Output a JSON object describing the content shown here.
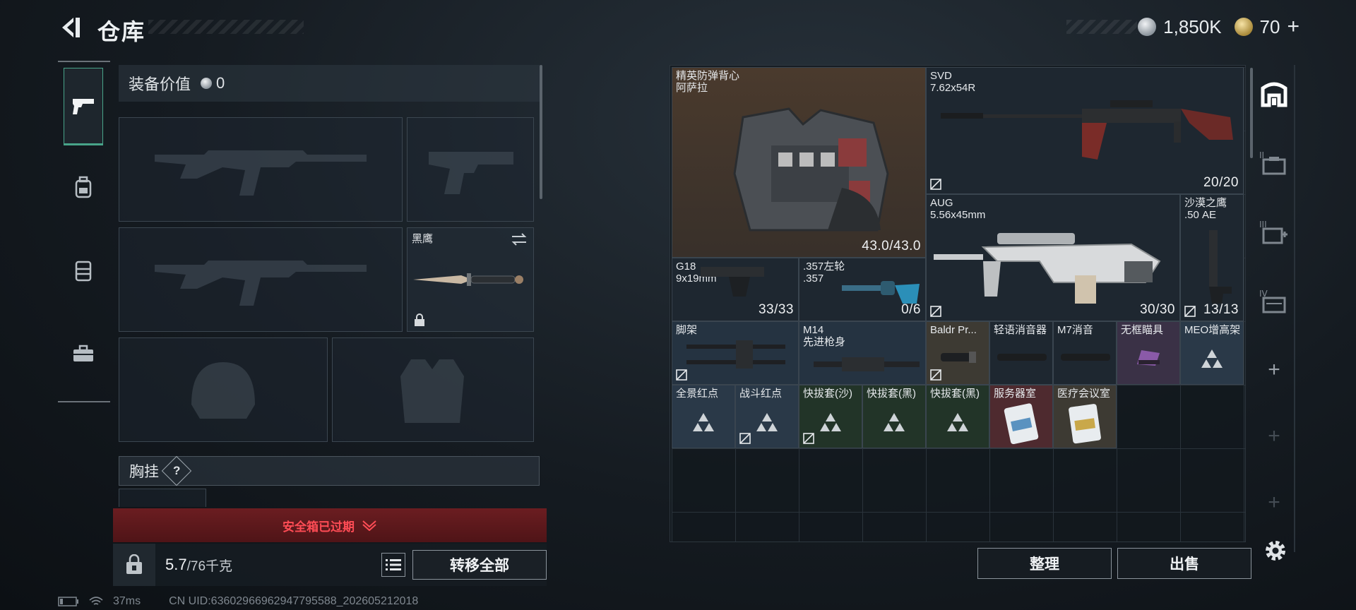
{
  "header": {
    "title": "仓库",
    "currency_silver": "1,850K",
    "currency_gold": "70",
    "gold_plus": "+"
  },
  "left_rail": {
    "items": [
      {
        "icon": "pistol-icon",
        "active": true
      },
      {
        "icon": "backpack-icon",
        "active": false
      },
      {
        "icon": "vest-icon",
        "active": false
      },
      {
        "icon": "toolbox-icon",
        "active": false
      }
    ]
  },
  "loadout": {
    "equip_value_label": "装备价值",
    "equip_value": "0",
    "melee_name": "黑鹰",
    "chest_rig_label": "胸挂",
    "chest_rig_help": "?"
  },
  "safebox": {
    "banner": "安全箱已过期"
  },
  "capacity": {
    "current": "5.7",
    "max": "/76千克",
    "transfer_all": "转移全部"
  },
  "status": {
    "ping": "37ms",
    "uid": "CN UID:63602966962947795588_202605212018"
  },
  "storage": {
    "items": [
      {
        "name": "精英防弹背心\n阿萨拉",
        "count": "43.0/43.0"
      },
      {
        "name": "SVD\n7.62x54R",
        "count": "20/20"
      },
      {
        "name": "AUG\n5.56x45mm",
        "count": "30/30"
      },
      {
        "name": "沙漠之鹰\n.50 AE",
        "count": "13/13"
      },
      {
        "name": "G18\n9x19mm",
        "count": "33/33"
      },
      {
        "name": ".357左轮\n.357",
        "count": "0/6"
      },
      {
        "name": "脚架",
        "count": ""
      },
      {
        "name": "M14\n先进枪身",
        "count": ""
      },
      {
        "name": "Baldr Pr...",
        "count": ""
      },
      {
        "name": "轻语消音器",
        "count": ""
      },
      {
        "name": "M7消音",
        "count": ""
      },
      {
        "name": "无框瞄具",
        "count": ""
      },
      {
        "name": "MEO增高架",
        "count": ""
      },
      {
        "name": "全景红点",
        "count": ""
      },
      {
        "name": "战斗红点",
        "count": ""
      },
      {
        "name": "快拔套(沙)",
        "count": ""
      },
      {
        "name": "快拔套(黑)",
        "count": ""
      },
      {
        "name": "快拔套(黑)",
        "count": ""
      },
      {
        "name": "服务器室",
        "count": ""
      },
      {
        "name": "医疗会议室",
        "count": ""
      }
    ],
    "sort_label": "整理",
    "sell_label": "出售",
    "add_tab": "+"
  },
  "right_rail": {
    "tabs": [
      {
        "icon": "storage-home-icon"
      },
      {
        "icon": "storage-tab-2-icon",
        "label": "II"
      },
      {
        "icon": "storage-tab-3-icon",
        "label": "III"
      },
      {
        "icon": "storage-tab-4-icon",
        "label": "IV"
      }
    ]
  },
  "colors": {
    "accent_green": "#48a489",
    "warning_red": "#ff4c55",
    "banner_red": "#6b1d21"
  }
}
